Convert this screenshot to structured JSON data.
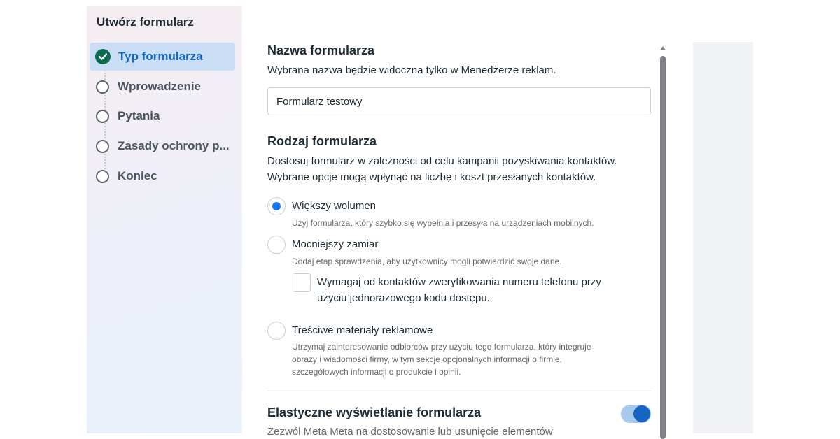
{
  "sidebar": {
    "title": "Utwórz formularz",
    "steps": [
      {
        "label": "Typ formularza",
        "state": "completed-active"
      },
      {
        "label": "Wprowadzenie",
        "state": "pending"
      },
      {
        "label": "Pytania",
        "state": "pending"
      },
      {
        "label": "Zasady ochrony p...",
        "state": "pending"
      },
      {
        "label": "Koniec",
        "state": "pending"
      }
    ]
  },
  "form_name": {
    "heading": "Nazwa formularza",
    "description": "Wybrana nazwa będzie widoczna tylko w Menedżerze reklam.",
    "value": "Formularz testowy"
  },
  "form_type": {
    "heading": "Rodzaj formularza",
    "description_line1": "Dostosuj formularz w zależności od celu kampanii pozyskiwania kontaktów.",
    "description_line2": "Wybrane opcje mogą wpłynąć na liczbę i koszt przesłanych kontaktów.",
    "options": [
      {
        "title": "Większy wolumen",
        "description": "Użyj formularza, który szybko się wypełnia i przesyła na urządzeniach mobilnych.",
        "selected": true
      },
      {
        "title": "Mocniejszy zamiar",
        "description": "Dodaj etap sprawdzenia, aby użytkownicy mogli potwierdzić swoje dane.",
        "selected": false
      },
      {
        "title": "Treściwe materiały reklamowe",
        "description_line1": "Utrzymaj zainteresowanie odbiorców przy użyciu tego formularza, który integruje",
        "description_line2": "obrazy i wiadomości firmy, w tym sekcje opcjonalnych informacji o firmie,",
        "description_line3": "szczegółowych informacji o produkcie i opinii.",
        "selected": false
      }
    ],
    "verify_checkbox": {
      "line1": "Wymagaj od kontaktów zweryfikowania numeru telefonu przy",
      "line2": "użyciu jednorazowego kodu dostępu.",
      "checked": false
    }
  },
  "flexible_display": {
    "heading": "Elastyczne wyświetlanie formularza",
    "description": "Zezwól Meta Meta na dostosowanie lub usunięcie elementów",
    "toggle_on": true
  },
  "colors": {
    "accent": "#1877f2",
    "active_step_bg": "#c9def5",
    "check_green": "#0b6b4f"
  }
}
